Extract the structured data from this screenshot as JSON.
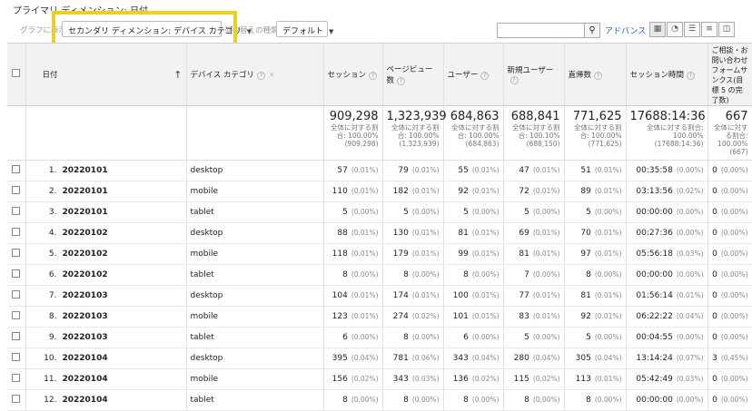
{
  "breadcrumb": "プライマリ ディメンション: 日付",
  "toolbar": {
    "graph_label": "グラフに表示",
    "secondary_dim": "セカンダリ ディメンション: デバイス カテゴリ",
    "sort_label": "並べ替えの種類:",
    "sort_value": "デフォルト",
    "advanced": "アドバンス",
    "search_value": "",
    "search_icon": "magnifier-icon",
    "views": [
      "grid-view-icon",
      "pie-view-icon",
      "performance-view-icon",
      "comparison-view-icon",
      "pivot-view-icon"
    ]
  },
  "headers": {
    "date": "日付",
    "device": "デバイス カテゴリ",
    "sessions": "セッション",
    "pageviews": "ページビュー数",
    "users": "ユーザー",
    "new_users": "新規ユーザー",
    "bounces": "直帰数",
    "session_time": "セッション時間",
    "goal": "ご相談・お問い合わせフォームサンクス(目標 5 の完了数)",
    "help": "?"
  },
  "totals": [
    {
      "value": "909,298",
      "share": "全体に対する割合: 100.00% (909,298)"
    },
    {
      "value": "1,323,939",
      "share": "全体に対する割合: 100.00% (1,323,939)"
    },
    {
      "value": "684,863",
      "share": "全体に対する割合: 100.00% (684,863)"
    },
    {
      "value": "688,841",
      "share": "全体に対する割合: 100.10% (688,150)"
    },
    {
      "value": "771,625",
      "share": "全体に対する割合: 100.00% (771,625)"
    },
    {
      "value": "17688:14:36",
      "share": "全体に対する割合: 100.00% (17688:14:36)"
    },
    {
      "value": "667",
      "share": "全体に対する割合: 100.00% (667)"
    }
  ],
  "rows": [
    {
      "idx": "1.",
      "date": "20220101",
      "device": "desktop",
      "cells": [
        [
          "57",
          "(0.01%)"
        ],
        [
          "79",
          "(0.01%)"
        ],
        [
          "55",
          "(0.01%)"
        ],
        [
          "47",
          "(0.01%)"
        ],
        [
          "51",
          "(0.01%)"
        ],
        [
          "00:35:58",
          "(0.00%)"
        ],
        [
          "0",
          "(0.00%)"
        ]
      ]
    },
    {
      "idx": "2.",
      "date": "20220101",
      "device": "mobile",
      "cells": [
        [
          "110",
          "(0.01%)"
        ],
        [
          "182",
          "(0.01%)"
        ],
        [
          "92",
          "(0.01%)"
        ],
        [
          "72",
          "(0.01%)"
        ],
        [
          "89",
          "(0.01%)"
        ],
        [
          "03:13:56",
          "(0.02%)"
        ],
        [
          "0",
          "(0.00%)"
        ]
      ]
    },
    {
      "idx": "3.",
      "date": "20220101",
      "device": "tablet",
      "cells": [
        [
          "5",
          "(0.00%)"
        ],
        [
          "5",
          "(0.00%)"
        ],
        [
          "5",
          "(0.00%)"
        ],
        [
          "5",
          "(0.00%)"
        ],
        [
          "5",
          "(0.00%)"
        ],
        [
          "00:00:00",
          "(0.00%)"
        ],
        [
          "0",
          "(0.00%)"
        ]
      ]
    },
    {
      "idx": "4.",
      "date": "20220102",
      "device": "desktop",
      "cells": [
        [
          "88",
          "(0.01%)"
        ],
        [
          "130",
          "(0.01%)"
        ],
        [
          "81",
          "(0.01%)"
        ],
        [
          "69",
          "(0.01%)"
        ],
        [
          "70",
          "(0.01%)"
        ],
        [
          "00:27:36",
          "(0.00%)"
        ],
        [
          "0",
          "(0.00%)"
        ]
      ]
    },
    {
      "idx": "5.",
      "date": "20220102",
      "device": "mobile",
      "cells": [
        [
          "118",
          "(0.01%)"
        ],
        [
          "179",
          "(0.01%)"
        ],
        [
          "99",
          "(0.01%)"
        ],
        [
          "81",
          "(0.01%)"
        ],
        [
          "97",
          "(0.01%)"
        ],
        [
          "05:56:18",
          "(0.03%)"
        ],
        [
          "0",
          "(0.00%)"
        ]
      ]
    },
    {
      "idx": "6.",
      "date": "20220102",
      "device": "tablet",
      "cells": [
        [
          "8",
          "(0.00%)"
        ],
        [
          "8",
          "(0.00%)"
        ],
        [
          "8",
          "(0.00%)"
        ],
        [
          "7",
          "(0.00%)"
        ],
        [
          "8",
          "(0.00%)"
        ],
        [
          "00:00:00",
          "(0.00%)"
        ],
        [
          "0",
          "(0.00%)"
        ]
      ]
    },
    {
      "idx": "7.",
      "date": "20220103",
      "device": "desktop",
      "cells": [
        [
          "104",
          "(0.01%)"
        ],
        [
          "174",
          "(0.01%)"
        ],
        [
          "100",
          "(0.01%)"
        ],
        [
          "77",
          "(0.01%)"
        ],
        [
          "81",
          "(0.01%)"
        ],
        [
          "01:56:14",
          "(0.01%)"
        ],
        [
          "0",
          "(0.00%)"
        ]
      ]
    },
    {
      "idx": "8.",
      "date": "20220103",
      "device": "mobile",
      "cells": [
        [
          "123",
          "(0.01%)"
        ],
        [
          "274",
          "(0.02%)"
        ],
        [
          "101",
          "(0.01%)"
        ],
        [
          "83",
          "(0.01%)"
        ],
        [
          "92",
          "(0.01%)"
        ],
        [
          "06:22:22",
          "(0.04%)"
        ],
        [
          "0",
          "(0.00%)"
        ]
      ]
    },
    {
      "idx": "9.",
      "date": "20220103",
      "device": "tablet",
      "cells": [
        [
          "6",
          "(0.00%)"
        ],
        [
          "8",
          "(0.00%)"
        ],
        [
          "6",
          "(0.00%)"
        ],
        [
          "5",
          "(0.00%)"
        ],
        [
          "5",
          "(0.00%)"
        ],
        [
          "00:04:55",
          "(0.00%)"
        ],
        [
          "0",
          "(0.00%)"
        ]
      ]
    },
    {
      "idx": "10.",
      "date": "20220104",
      "device": "desktop",
      "cells": [
        [
          "395",
          "(0.04%)"
        ],
        [
          "781",
          "(0.06%)"
        ],
        [
          "343",
          "(0.04%)"
        ],
        [
          "280",
          "(0.04%)"
        ],
        [
          "305",
          "(0.04%)"
        ],
        [
          "13:14:24",
          "(0.07%)"
        ],
        [
          "3",
          "(0.45%)"
        ]
      ]
    },
    {
      "idx": "11.",
      "date": "20220104",
      "device": "mobile",
      "cells": [
        [
          "156",
          "(0.02%)"
        ],
        [
          "343",
          "(0.03%)"
        ],
        [
          "136",
          "(0.02%)"
        ],
        [
          "115",
          "(0.02%)"
        ],
        [
          "113",
          "(0.01%)"
        ],
        [
          "05:42:49",
          "(0.03%)"
        ],
        [
          "0",
          "(0.00%)"
        ]
      ]
    },
    {
      "idx": "12.",
      "date": "20220104",
      "device": "tablet",
      "cells": [
        [
          "8",
          "(0.00%)"
        ],
        [
          "8",
          "(0.00%)"
        ],
        [
          "8",
          "(0.00%)"
        ],
        [
          "8",
          "(0.00%)"
        ],
        [
          "8",
          "(0.00%)"
        ],
        [
          "00:00:00",
          "(0.00%)"
        ],
        [
          "0",
          "(0.00%)"
        ]
      ]
    }
  ]
}
